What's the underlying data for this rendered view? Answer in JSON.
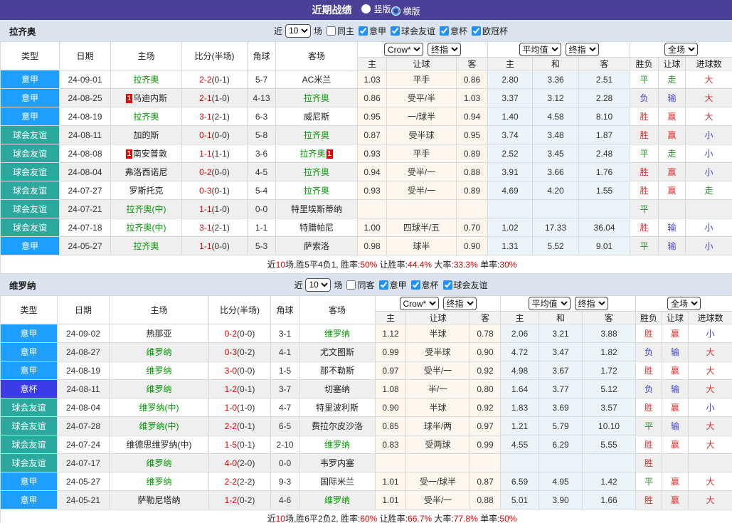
{
  "topbar": {
    "title": "近期战绩",
    "radios": [
      {
        "label": "竖版",
        "selected": true
      },
      {
        "label": "横版",
        "selected": false
      }
    ]
  },
  "colors": {
    "topbar_bg": "#4A4098",
    "band_bg": "#DAE3EE",
    "league": {
      "意甲": "#1E9FFF",
      "球会友谊": "#2BA99F",
      "意杯": "#3B3BE8"
    },
    "team_green": "#009900",
    "score_red": "#E60000",
    "result_chars": {
      "胜": "#DC3333",
      "赢": "#DC3333",
      "大": "#DC3333",
      "平": "#2E8B2E",
      "走": "#2E8B2E",
      "负": "#4040CC",
      "输": "#4040CC",
      "小": "#4040CC"
    }
  },
  "table_header": {
    "static_cols": [
      "类型",
      "日期",
      "主场",
      "比分(半场)",
      "角球",
      "客场"
    ],
    "crow_selects": [
      "Crow*",
      "终指"
    ],
    "avg_selects": [
      "平均值",
      "终指"
    ],
    "scope_select": "全场",
    "sub_cols": [
      "主",
      "让球",
      "客",
      "主",
      "和",
      "客",
      "胜负",
      "让球",
      "进球数"
    ]
  },
  "sections": [
    {
      "team": "拉齐奥",
      "filter": {
        "near_label": "近",
        "count": "10",
        "games_label": "场",
        "same_label": "同主",
        "same_checked": false,
        "leagues": [
          {
            "label": "意甲",
            "checked": true
          },
          {
            "label": "球会友谊",
            "checked": true
          },
          {
            "label": "意杯",
            "checked": true
          },
          {
            "label": "欧冠杯",
            "checked": true
          }
        ]
      },
      "rows": [
        {
          "type": "意甲",
          "date": "24-09-01",
          "home": {
            "name": "拉齐奥",
            "green": true
          },
          "score": "2-2",
          "half": "(0-1)",
          "corners": "5-7",
          "away": {
            "name": "AC米兰",
            "green": false
          },
          "crow": [
            "1.03",
            "平手",
            "0.86"
          ],
          "avg": [
            "2.80",
            "3.36",
            "2.51"
          ],
          "results": [
            "平",
            "走",
            "大"
          ]
        },
        {
          "type": "意甲",
          "date": "24-08-25",
          "home": {
            "name": "乌迪内斯",
            "green": false,
            "card_pre": "1"
          },
          "score": "2-1",
          "half": "(1-0)",
          "corners": "4-13",
          "away": {
            "name": "拉齐奥",
            "green": true
          },
          "crow": [
            "0.86",
            "受平/半",
            "1.03"
          ],
          "avg": [
            "3.37",
            "3.12",
            "2.28"
          ],
          "results": [
            "负",
            "输",
            "大"
          ]
        },
        {
          "type": "意甲",
          "date": "24-08-19",
          "home": {
            "name": "拉齐奥",
            "green": true
          },
          "score": "3-1",
          "half": "(2-1)",
          "corners": "6-3",
          "away": {
            "name": "威尼斯",
            "green": false
          },
          "crow": [
            "0.95",
            "一/球半",
            "0.94"
          ],
          "avg": [
            "1.40",
            "4.58",
            "8.10"
          ],
          "results": [
            "胜",
            "赢",
            "大"
          ]
        },
        {
          "type": "球会友谊",
          "date": "24-08-11",
          "home": {
            "name": "加的斯",
            "green": false
          },
          "score": "0-1",
          "half": "(0-0)",
          "corners": "5-8",
          "away": {
            "name": "拉齐奥",
            "green": true
          },
          "crow": [
            "0.87",
            "受半球",
            "0.95"
          ],
          "avg": [
            "3.74",
            "3.48",
            "1.87"
          ],
          "results": [
            "胜",
            "赢",
            "小"
          ]
        },
        {
          "type": "球会友谊",
          "date": "24-08-08",
          "home": {
            "name": "南安普敦",
            "green": false,
            "card_pre": "1"
          },
          "score": "1-1",
          "half": "(1-1)",
          "corners": "3-6",
          "away": {
            "name": "拉齐奥",
            "green": true,
            "card_post": "1"
          },
          "crow": [
            "0.93",
            "平手",
            "0.89"
          ],
          "avg": [
            "2.52",
            "3.45",
            "2.48"
          ],
          "results": [
            "平",
            "走",
            "小"
          ]
        },
        {
          "type": "球会友谊",
          "date": "24-08-04",
          "home": {
            "name": "弗洛西诺尼",
            "green": false
          },
          "score": "0-2",
          "half": "(0-0)",
          "corners": "4-5",
          "away": {
            "name": "拉齐奥",
            "green": true
          },
          "crow": [
            "0.94",
            "受半/一",
            "0.88"
          ],
          "avg": [
            "3.91",
            "3.66",
            "1.76"
          ],
          "results": [
            "胜",
            "赢",
            "小"
          ]
        },
        {
          "type": "球会友谊",
          "date": "24-07-27",
          "home": {
            "name": "罗斯托克",
            "green": false
          },
          "score": "0-3",
          "half": "(0-1)",
          "corners": "5-4",
          "away": {
            "name": "拉齐奥",
            "green": true
          },
          "crow": [
            "0.93",
            "受半/一",
            "0.89"
          ],
          "avg": [
            "4.69",
            "4.20",
            "1.55"
          ],
          "results": [
            "胜",
            "赢",
            "走"
          ]
        },
        {
          "type": "球会友谊",
          "date": "24-07-21",
          "home": {
            "name": "拉齐奥(中)",
            "green": true
          },
          "score": "1-1",
          "half": "(1-0)",
          "corners": "0-0",
          "away": {
            "name": "特里埃斯蒂纳",
            "green": false
          },
          "crow": [
            "",
            "",
            ""
          ],
          "avg": [
            "",
            "",
            ""
          ],
          "results": [
            "平",
            "",
            ""
          ]
        },
        {
          "type": "球会友谊",
          "date": "24-07-18",
          "home": {
            "name": "拉齐奥(中)",
            "green": true
          },
          "score": "3-1",
          "half": "(2-1)",
          "corners": "1-1",
          "away": {
            "name": "特腊帕尼",
            "green": false
          },
          "crow": [
            "1.00",
            "四球半/五",
            "0.70"
          ],
          "avg": [
            "1.02",
            "17.33",
            "36.04"
          ],
          "results": [
            "胜",
            "输",
            "小"
          ]
        },
        {
          "type": "意甲",
          "date": "24-05-27",
          "home": {
            "name": "拉齐奥",
            "green": true
          },
          "score": "1-1",
          "half": "(0-0)",
          "corners": "5-3",
          "away": {
            "name": "萨索洛",
            "green": false
          },
          "crow": [
            "0.98",
            "球半",
            "0.90"
          ],
          "avg": [
            "1.31",
            "5.52",
            "9.01"
          ],
          "results": [
            "平",
            "输",
            "小"
          ]
        }
      ],
      "summary": [
        {
          "text": "近",
          "red": false
        },
        {
          "text": "10",
          "red": true
        },
        {
          "text": "场,胜5平4负1, 胜率:",
          "red": false
        },
        {
          "text": "50%",
          "red": true
        },
        {
          "text": " 让胜率:",
          "red": false
        },
        {
          "text": "44.4%",
          "red": true
        },
        {
          "text": " 大率:",
          "red": false
        },
        {
          "text": "33.3%",
          "red": true
        },
        {
          "text": " 单率:",
          "red": false
        },
        {
          "text": "30%",
          "red": true
        }
      ]
    },
    {
      "team": "维罗纳",
      "filter": {
        "near_label": "近",
        "count": "10",
        "games_label": "场",
        "same_label": "同客",
        "same_checked": false,
        "leagues": [
          {
            "label": "意甲",
            "checked": true
          },
          {
            "label": "意杯",
            "checked": true
          },
          {
            "label": "球会友谊",
            "checked": true
          }
        ]
      },
      "rows": [
        {
          "type": "意甲",
          "date": "24-09-02",
          "home": {
            "name": "热那亚",
            "green": false
          },
          "score": "0-2",
          "half": "(0-0)",
          "corners": "3-1",
          "away": {
            "name": "维罗纳",
            "green": true
          },
          "crow": [
            "1.12",
            "半球",
            "0.78"
          ],
          "avg": [
            "2.06",
            "3.21",
            "3.88"
          ],
          "results": [
            "胜",
            "赢",
            "小"
          ]
        },
        {
          "type": "意甲",
          "date": "24-08-27",
          "home": {
            "name": "维罗纳",
            "green": true
          },
          "score": "0-3",
          "half": "(0-2)",
          "corners": "4-1",
          "away": {
            "name": "尤文图斯",
            "green": false
          },
          "crow": [
            "0.99",
            "受半球",
            "0.90"
          ],
          "avg": [
            "4.72",
            "3.47",
            "1.82"
          ],
          "results": [
            "负",
            "输",
            "大"
          ]
        },
        {
          "type": "意甲",
          "date": "24-08-19",
          "home": {
            "name": "维罗纳",
            "green": true
          },
          "score": "3-0",
          "half": "(0-0)",
          "corners": "1-5",
          "away": {
            "name": "那不勒斯",
            "green": false
          },
          "crow": [
            "0.97",
            "受半/一",
            "0.92"
          ],
          "avg": [
            "4.98",
            "3.67",
            "1.72"
          ],
          "results": [
            "胜",
            "赢",
            "大"
          ]
        },
        {
          "type": "意杯",
          "date": "24-08-11",
          "home": {
            "name": "维罗纳",
            "green": true
          },
          "score": "1-2",
          "half": "(0-1)",
          "corners": "3-7",
          "away": {
            "name": "切塞纳",
            "green": false
          },
          "crow": [
            "1.08",
            "半/一",
            "0.80"
          ],
          "avg": [
            "1.64",
            "3.77",
            "5.12"
          ],
          "results": [
            "负",
            "输",
            "大"
          ]
        },
        {
          "type": "球会友谊",
          "date": "24-08-04",
          "home": {
            "name": "维罗纳(中)",
            "green": true
          },
          "score": "1-0",
          "half": "(1-0)",
          "corners": "4-7",
          "away": {
            "name": "特里波利斯",
            "green": false
          },
          "crow": [
            "0.90",
            "半球",
            "0.92"
          ],
          "avg": [
            "1.83",
            "3.69",
            "3.57"
          ],
          "results": [
            "胜",
            "赢",
            "小"
          ]
        },
        {
          "type": "球会友谊",
          "date": "24-07-28",
          "home": {
            "name": "维罗纳(中)",
            "green": true
          },
          "score": "2-2",
          "half": "(0-1)",
          "corners": "6-5",
          "away": {
            "name": "费拉尔皮沙洛",
            "green": false
          },
          "crow": [
            "0.85",
            "球半/两",
            "0.97"
          ],
          "avg": [
            "1.21",
            "5.79",
            "10.10"
          ],
          "results": [
            "平",
            "输",
            "大"
          ]
        },
        {
          "type": "球会友谊",
          "date": "24-07-24",
          "home": {
            "name": "维德思维罗纳(中)",
            "green": false
          },
          "score": "1-5",
          "half": "(0-1)",
          "corners": "2-10",
          "away": {
            "name": "维罗纳",
            "green": true
          },
          "crow": [
            "0.83",
            "受两球",
            "0.99"
          ],
          "avg": [
            "4.55",
            "6.29",
            "5.55"
          ],
          "results": [
            "胜",
            "赢",
            "大"
          ]
        },
        {
          "type": "球会友谊",
          "date": "24-07-17",
          "home": {
            "name": "维罗纳",
            "green": true
          },
          "score": "4-0",
          "half": "(2-0)",
          "corners": "0-0",
          "away": {
            "name": "韦罗内塞",
            "green": false
          },
          "crow": [
            "",
            "",
            ""
          ],
          "avg": [
            "",
            "",
            ""
          ],
          "results": [
            "胜",
            "",
            ""
          ]
        },
        {
          "type": "意甲",
          "date": "24-05-27",
          "home": {
            "name": "维罗纳",
            "green": true
          },
          "score": "2-2",
          "half": "(2-2)",
          "corners": "9-3",
          "away": {
            "name": "国际米兰",
            "green": false
          },
          "crow": [
            "1.01",
            "受一/球半",
            "0.87"
          ],
          "avg": [
            "6.59",
            "4.95",
            "1.42"
          ],
          "results": [
            "平",
            "赢",
            "大"
          ]
        },
        {
          "type": "意甲",
          "date": "24-05-21",
          "home": {
            "name": "萨勒尼塔纳",
            "green": false
          },
          "score": "1-2",
          "half": "(0-2)",
          "corners": "4-6",
          "away": {
            "name": "维罗纳",
            "green": true
          },
          "crow": [
            "1.01",
            "受半/一",
            "0.88"
          ],
          "avg": [
            "5.01",
            "3.90",
            "1.66"
          ],
          "results": [
            "胜",
            "赢",
            "大"
          ]
        }
      ],
      "summary": [
        {
          "text": "近",
          "red": false
        },
        {
          "text": "10",
          "red": true
        },
        {
          "text": "场,胜6平2负2, 胜率:",
          "red": false
        },
        {
          "text": "60%",
          "red": true
        },
        {
          "text": " 让胜率:",
          "red": false
        },
        {
          "text": "66.7%",
          "red": true
        },
        {
          "text": " 大率:",
          "red": false
        },
        {
          "text": "77.8%",
          "red": true
        },
        {
          "text": " 单率:",
          "red": false
        },
        {
          "text": "50%",
          "red": true
        }
      ]
    }
  ]
}
